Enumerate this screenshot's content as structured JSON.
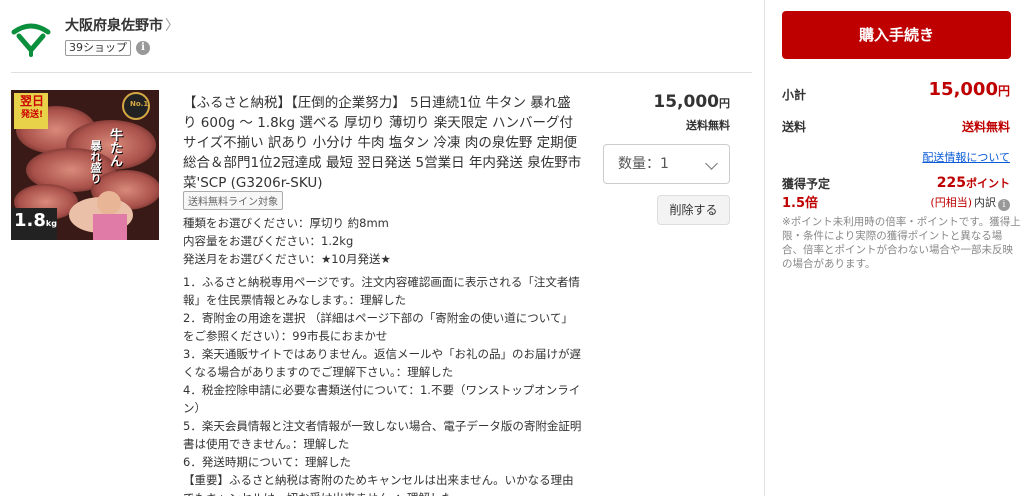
{
  "shop": {
    "name": "大阪府泉佐野市",
    "chevron": "〉",
    "badge": "39ショップ",
    "info_icon": "i"
  },
  "product": {
    "title": "【ふるさと納税】【圧倒的企業努力】 5日連続1位 牛タン 暴れ盛り 600g ～ 1.8kg 選べる 厚切り 薄切り 楽天限定 ハンバーグ付 サイズ不揃い 訳あり 小分け 牛肉 塩タン 冷凍 肉の泉佐野 定期便 総合＆部門1位2冠達成 最短 翌日発送 5営業日 年内発送 泉佐野市 菜'SCP (G3206r-SKU)",
    "tag": "送料無料ライン対象",
    "image": {
      "badge_line1": "翌日",
      "badge_line2": "発送!",
      "name_line1": "牛たん",
      "name_line2": "暴れ盛り",
      "size_big": "1.8",
      "size_unit": "kg",
      "rank": "No.1"
    },
    "options": [
      "種類をお選びください：厚切り 約8mm",
      "内容量をお選びください：1.2kg",
      "発送月をお選びください：★10月発送★"
    ],
    "notes": [
      "1．ふるさと納税専用ページです。注文内容確認画面に表示される「注文者情報」を住民票情報とみなします。：理解した",
      "2．寄附金の用途を選択 （詳細はページ下部の「寄附金の使い道について」をご参照ください）：99市長におまかせ",
      "3．楽天通販サイトではありません。返信メールや「お礼の品」のお届けが遅くなる場合がありますのでご理解下さい。：理解した",
      "4．税金控除申請に必要な書類送付について：1.不要（ワンストップオンライン）",
      "5．楽天会員情報と注文者情報が一致しない場合、電子データ版の寄附金証明書は使用できません。：理解した",
      "6．発送時期について：理解した",
      "【重要】ふるさと納税は寄附のためキャンセルは出来ません。いかなる理由でもキャンセルは一切お受け出来ません。：理解した"
    ],
    "price": "15,000",
    "currency": "円",
    "shipping": "送料無料",
    "quantity_label": "数量：1",
    "delete_button": "削除する"
  },
  "summary": {
    "buy_button": "購入手続き",
    "subtotal_label": "小計",
    "subtotal_value": "15,000",
    "currency": "円",
    "shipping_label": "送料",
    "shipping_value": "送料無料",
    "shipping_link": "配送情報について",
    "points_label": "獲得予定",
    "points_rate": "1.5倍",
    "points_value": "225",
    "points_unit": "ポイント",
    "points_equiv": "(円相当)",
    "points_breakdown": "内訳",
    "points_note": "※ポイント未利用時の倍率・ポイントです。獲得上限・条件により実際の獲得ポイントと異なる場合、倍率とポイントが合わない場合や一部未反映の場合があります。"
  },
  "colors": {
    "accent": "#bf0000",
    "link": "#0b5bd8",
    "logo_green": "#0a8f3c"
  }
}
